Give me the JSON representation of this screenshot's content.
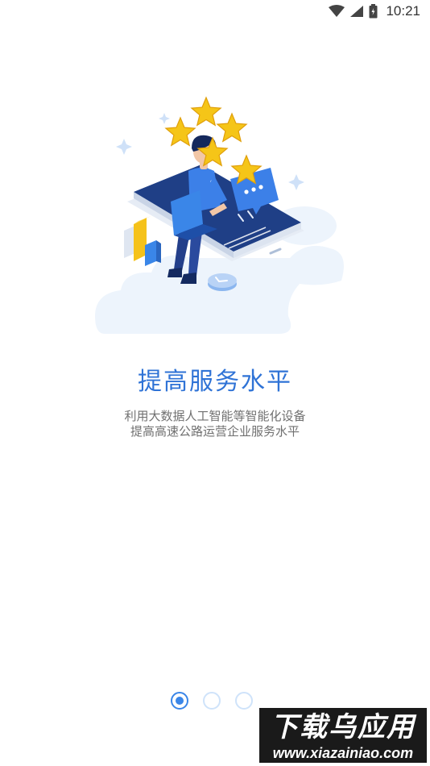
{
  "status_bar": {
    "time": "10:21",
    "icons": [
      "wifi-icon",
      "cell-signal-icon",
      "battery-icon"
    ]
  },
  "onboarding": {
    "title": "提高服务水平",
    "description_lines": [
      "利用大数据人工智能等智能化设备",
      "提高高速公路运营企业服务水平"
    ],
    "page_indicator": {
      "total": 3,
      "current": 1
    }
  },
  "watermark": {
    "title": "下载乌应用",
    "url": "www.xiazainiao.com"
  },
  "colors": {
    "accent": "#2f73d6",
    "dot_active": "#3a86e8",
    "dot_inactive": "#cfe3fa",
    "star": "#f5c518",
    "phone": "#1f3f86"
  }
}
